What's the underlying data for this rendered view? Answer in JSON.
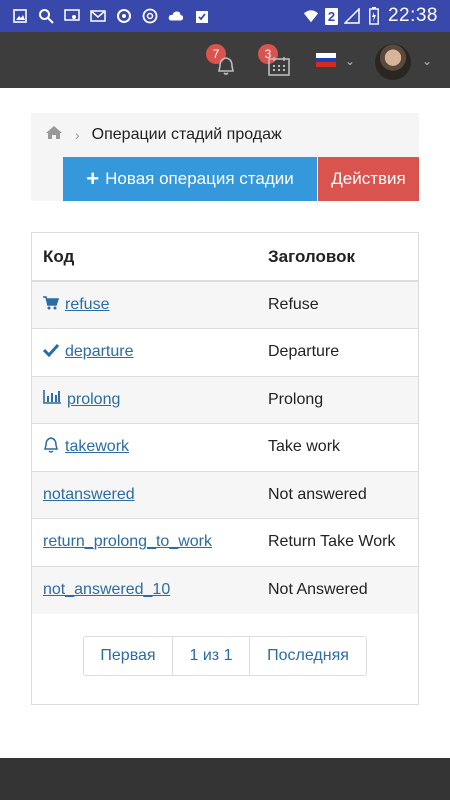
{
  "status_bar": {
    "time": "22:38",
    "sim_badge": "2",
    "icons": [
      "gallery-icon",
      "search-icon",
      "cast-icon",
      "mail-icon",
      "sync-icon",
      "chrome-icon",
      "cloud-icon",
      "clipboard-icon",
      "wifi-icon",
      "signal-icon",
      "battery-icon"
    ]
  },
  "appbar": {
    "notifications_count": "7",
    "calendar_count": "3",
    "language_flag": "ru",
    "colors": {
      "background": "#3d3d3d",
      "badge": "#d9534f"
    }
  },
  "breadcrumb": {
    "home_icon": "home-icon",
    "current": "Операции стадий продаж"
  },
  "toolbar": {
    "new_label": "Новая операция стадии",
    "actions_label": "Действия",
    "colors": {
      "new": "#3498db",
      "actions": "#d9534f"
    }
  },
  "table": {
    "headers": {
      "code": "Код",
      "title": "Заголовок"
    },
    "rows": [
      {
        "code": "refuse",
        "title": "Refuse",
        "icon": "cart-icon"
      },
      {
        "code": "departure",
        "title": "Departure",
        "icon": "check-icon"
      },
      {
        "code": "prolong",
        "title": "Prolong",
        "icon": "bar-chart-icon"
      },
      {
        "code": "takework",
        "title": "Take work",
        "icon": "bell-icon"
      },
      {
        "code": "notanswered",
        "title": "Not answered",
        "icon": ""
      },
      {
        "code": "return_prolong_to_work",
        "title": "Return Take Work",
        "icon": ""
      },
      {
        "code": "not_answered_10",
        "title": "Not Answered",
        "icon": ""
      }
    ]
  },
  "pagination": {
    "first": "Первая",
    "pages": "1 из 1",
    "last": "Последняя"
  }
}
